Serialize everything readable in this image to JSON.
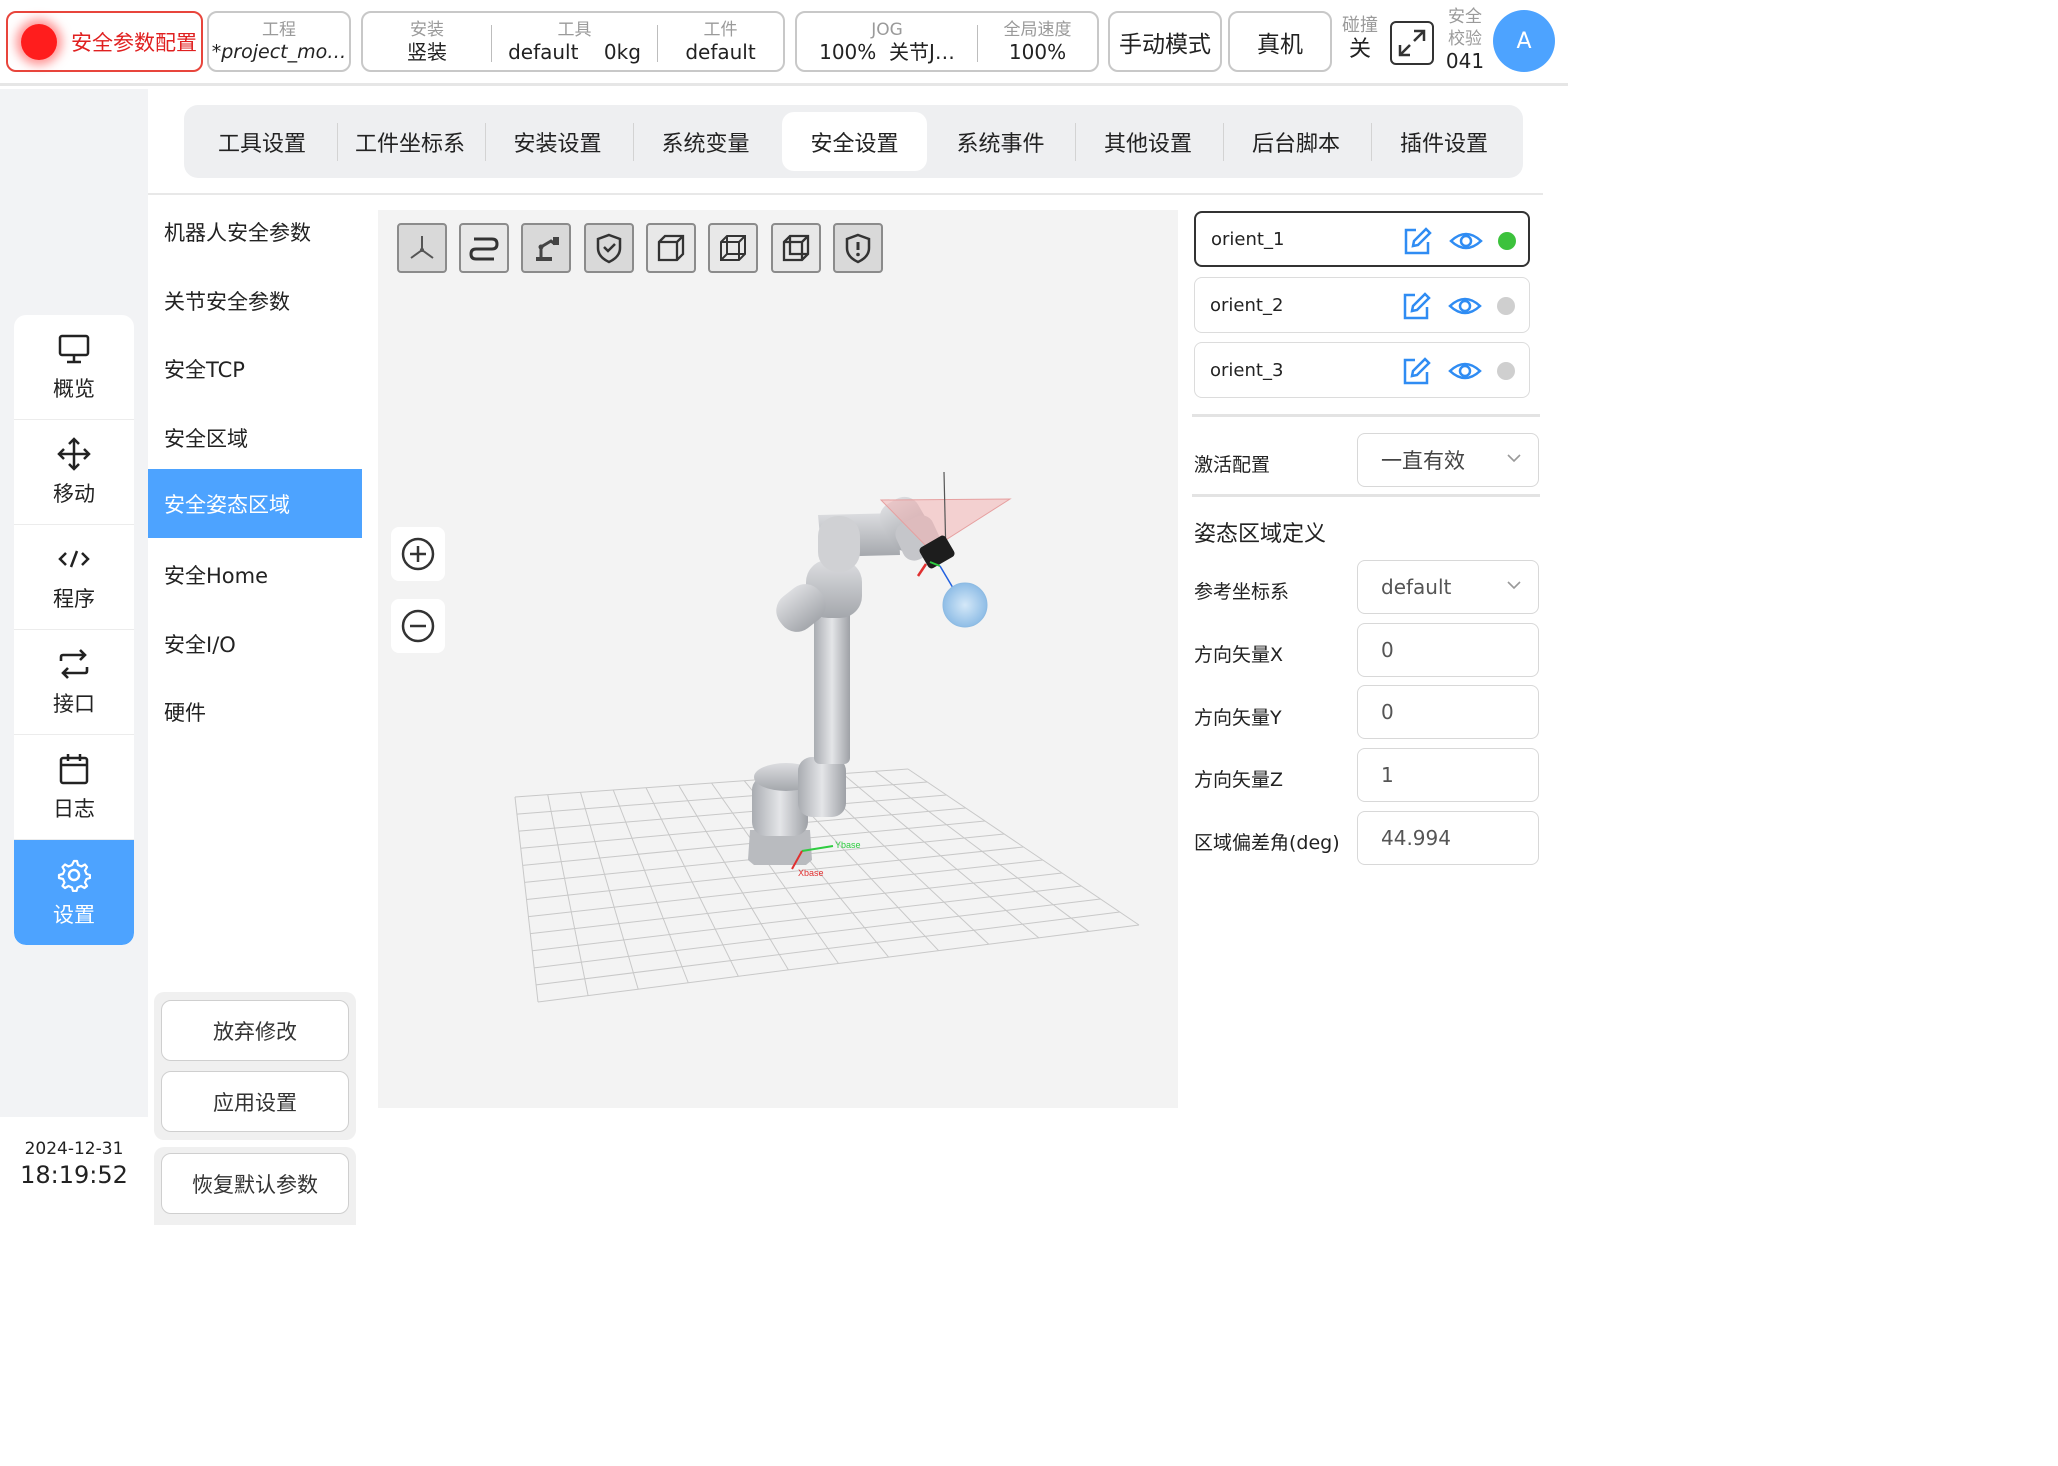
{
  "topbar": {
    "safety_config_label": "安全参数配置",
    "project": {
      "label": "工程",
      "value": "*project_mo…"
    },
    "install": {
      "label": "安装",
      "value": "竖装"
    },
    "tool": {
      "label": "工具",
      "value": "default",
      "weight": "0kg"
    },
    "workpiece": {
      "label": "工件",
      "value": "default"
    },
    "jog": {
      "label": "JOG",
      "value": "100%",
      "mode": "关节J…"
    },
    "global_speed": {
      "label": "全局速度",
      "value": "100%"
    },
    "manual_mode": "手动模式",
    "real_machine": "真机",
    "collision": {
      "label": "碰撞",
      "value": "关"
    },
    "safety_check": {
      "label": "安全校验",
      "value": "041"
    },
    "avatar_letter": "A"
  },
  "leftnav": {
    "items": [
      {
        "label": "概览",
        "icon": "monitor-icon"
      },
      {
        "label": "移动",
        "icon": "move-icon"
      },
      {
        "label": "程序",
        "icon": "code-icon"
      },
      {
        "label": "接口",
        "icon": "swap-icon"
      },
      {
        "label": "日志",
        "icon": "calendar-icon"
      },
      {
        "label": "设置",
        "icon": "gear-icon"
      }
    ],
    "active": "设置",
    "date": "2024-12-31",
    "time": "18:19:52"
  },
  "tabs": {
    "items": [
      "工具设置",
      "工件坐标系",
      "安装设置",
      "系统变量",
      "安全设置",
      "系统事件",
      "其他设置",
      "后台脚本",
      "插件设置"
    ],
    "active": "安全设置"
  },
  "submenu": {
    "items": [
      "机器人安全参数",
      "关节安全参数",
      "安全TCP",
      "安全区域",
      "安全姿态区域",
      "安全Home",
      "安全I/O",
      "硬件"
    ],
    "active": "安全姿态区域",
    "discard": "放弃修改",
    "apply": "应用设置",
    "restore": "恢复默认参数"
  },
  "viewport": {
    "toolbar_icons": [
      "axes-icon",
      "path-icon",
      "robot-arm-icon",
      "shield-check-icon",
      "cube-front-icon",
      "cube-wire-icon",
      "cube-side-icon",
      "shield-alert-icon"
    ],
    "zoom_in": "zoom-in-icon",
    "zoom_out": "zoom-out-icon",
    "base_x_label": "Xbase",
    "base_y_label": "Ybase"
  },
  "orient_list": [
    {
      "name": "orient_1",
      "status_color": "#3cc23c",
      "selected": true
    },
    {
      "name": "orient_2",
      "status_color": "#cfcfcf",
      "selected": false
    },
    {
      "name": "orient_3",
      "status_color": "#cfcfcf",
      "selected": false
    }
  ],
  "activation": {
    "label": "激活配置",
    "value": "一直有效"
  },
  "definition": {
    "title": "姿态区域定义",
    "ref_frame": {
      "label": "参考坐标系",
      "value": "default"
    },
    "dir_x": {
      "label": "方向矢量X",
      "value": "0"
    },
    "dir_y": {
      "label": "方向矢量Y",
      "value": "0"
    },
    "dir_z": {
      "label": "方向矢量Z",
      "value": "1"
    },
    "deviation": {
      "label": "区域偏差角(deg)",
      "value": "44.994"
    }
  }
}
